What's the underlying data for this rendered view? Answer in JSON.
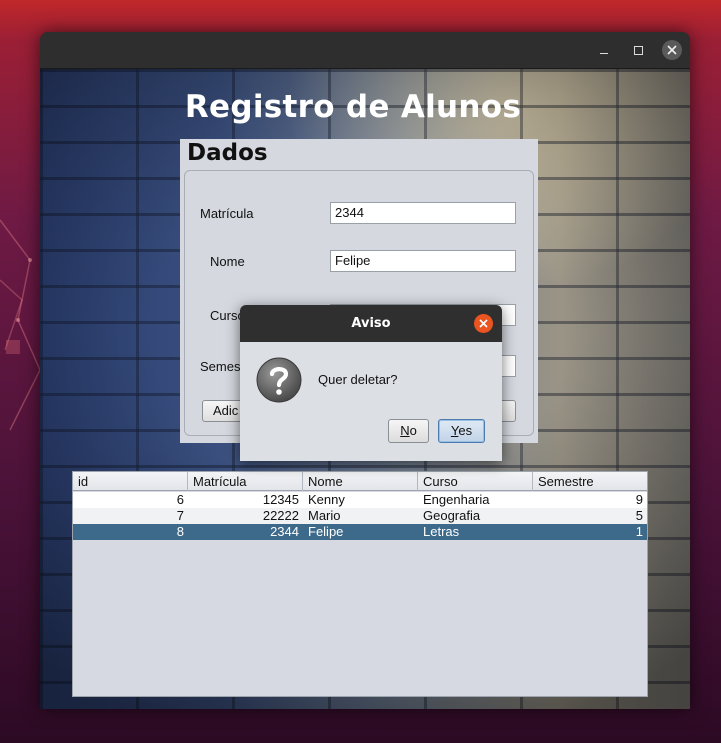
{
  "window": {
    "controls": [
      "minimize-icon",
      "maximize-icon",
      "close-icon"
    ]
  },
  "app": {
    "title": "Registro de Alunos"
  },
  "form": {
    "panel_title": "Dados",
    "matricula_label": "Matrícula",
    "matricula_value": "2344",
    "nome_label": "Nome",
    "nome_value": "Felipe",
    "curso_label": "Curso",
    "semestre_label": "Semes",
    "add_button_label": "Adic"
  },
  "table": {
    "columns": [
      "id",
      "Matrícula",
      "Nome",
      "Curso",
      "Semestre"
    ],
    "rows": [
      {
        "id": "6",
        "matricula": "12345",
        "nome": "Kenny",
        "curso": "Engenharia",
        "semestre": "9"
      },
      {
        "id": "7",
        "matricula": "22222",
        "nome": "Mario",
        "curso": "Geografia",
        "semestre": "5"
      },
      {
        "id": "8",
        "matricula": "2344",
        "nome": "Felipe",
        "curso": "Letras",
        "semestre": "1"
      }
    ],
    "selected_row": 2
  },
  "dialog": {
    "title": "Aviso",
    "message": "Quer deletar?",
    "icon": "question-icon",
    "no_mnemonic": "N",
    "no_rest": "o",
    "yes_mnemonic": "Y",
    "yes_rest": "es"
  },
  "colors": {
    "selection": "#3d6a8b",
    "dialog_close": "#e95420",
    "titlebar": "#2e2e2e"
  }
}
